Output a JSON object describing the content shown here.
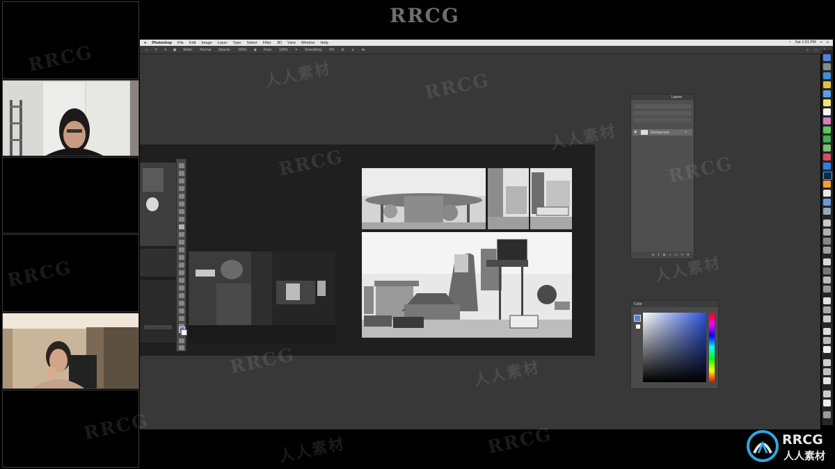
{
  "watermark_text": "RRCG",
  "watermark_secondary": "人人素材",
  "logo": {
    "text_top": "RRCG",
    "text_bottom": "人人素材"
  },
  "menubar": {
    "apple": "",
    "app_name": "Photoshop",
    "items": [
      "File",
      "Edit",
      "Image",
      "Layer",
      "Type",
      "Select",
      "Filter",
      "3D",
      "View",
      "Window",
      "Help"
    ],
    "clock": "Sat 1:51 PM"
  },
  "options_bar": {
    "mode_label": "Mode:",
    "mode_value": "Normal",
    "opacity_label": "Opacity:",
    "opacity_value": "100%",
    "flow_label": "Flow:",
    "flow_value": "100%",
    "smoothing_label": "Smoothing:",
    "smoothing_value": "0%"
  },
  "layers_panel": {
    "tab_label": "Layers",
    "layer_name": "Background"
  },
  "color_panel": {
    "tab_label": "Color"
  },
  "colors": {
    "ps_canvas": "#383838",
    "ps_panel": "#4f4f4f",
    "picker_hue": "#2b4fd6"
  }
}
